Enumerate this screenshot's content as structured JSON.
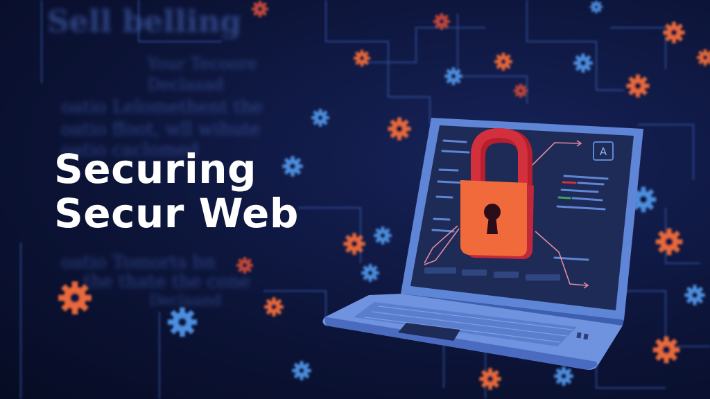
{
  "title": {
    "line1": "Securing",
    "line2": "Secur Web"
  },
  "background_text": [
    "Sell belling",
    "Your Tecoore",
    "Declasad",
    "oatio Lelomethent the",
    "oatio ffoot, wll wihute",
    "oatio caclomed",
    "oatio Tomorts bn",
    "the thate the cone",
    "Declaand"
  ],
  "laptop": {
    "screen_icon": "A",
    "lock": "padlock-icon"
  },
  "colors": {
    "background": "#0b1230",
    "accent_orange": "#e8693a",
    "accent_blue": "#4e8fe0",
    "lock_red": "#d2303c",
    "lock_orange": "#f06a3c",
    "laptop_frame": "#5f86d6"
  }
}
